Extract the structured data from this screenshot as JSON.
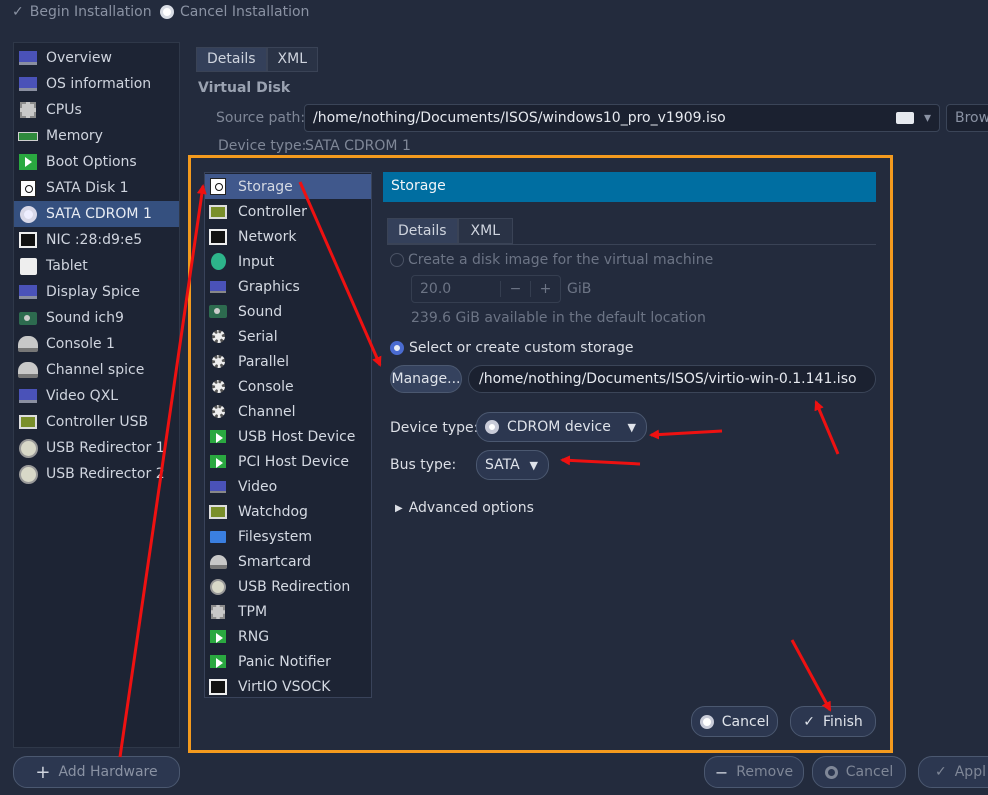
{
  "toolbar": {
    "begin": "Begin Installation",
    "cancel": "Cancel Installation"
  },
  "sidebar": {
    "items": [
      {
        "label": "Overview",
        "icon": "monitor-icon"
      },
      {
        "label": "OS information",
        "icon": "monitor-icon"
      },
      {
        "label": "CPUs",
        "icon": "cpu-icon"
      },
      {
        "label": "Memory",
        "icon": "memory-icon"
      },
      {
        "label": "Boot Options",
        "icon": "boot-icon"
      },
      {
        "label": "SATA Disk 1",
        "icon": "disk-icon"
      },
      {
        "label": "SATA CDROM 1",
        "icon": "cdrom-icon",
        "selected": true
      },
      {
        "label": "NIC :28:d9:e5",
        "icon": "nic-icon"
      },
      {
        "label": "Tablet",
        "icon": "tablet-icon"
      },
      {
        "label": "Display Spice",
        "icon": "display-icon"
      },
      {
        "label": "Sound ich9",
        "icon": "sound-icon"
      },
      {
        "label": "Console 1",
        "icon": "console-icon"
      },
      {
        "label": "Channel spice",
        "icon": "channel-icon"
      },
      {
        "label": "Video QXL",
        "icon": "video-icon"
      },
      {
        "label": "Controller USB",
        "icon": "controller-icon"
      },
      {
        "label": "USB Redirector 1",
        "icon": "usb-icon"
      },
      {
        "label": "USB Redirector 2",
        "icon": "usb-icon"
      }
    ],
    "add_hardware": "Add Hardware"
  },
  "main": {
    "tabs": [
      "Details",
      "XML"
    ],
    "section_title": "Virtual Disk",
    "source_path_label": "Source path:",
    "source_path_value": "/home/nothing/Documents/ISOS/windows10_pro_v1909.iso",
    "browse_label": "Brow",
    "device_type_label": "Device type:",
    "device_type_value": "SATA CDROM 1"
  },
  "dialog": {
    "hw_list": [
      {
        "label": "Storage",
        "icon": "storage-icon",
        "selected": true
      },
      {
        "label": "Controller",
        "icon": "controller-icon"
      },
      {
        "label": "Network",
        "icon": "network-icon"
      },
      {
        "label": "Input",
        "icon": "input-icon"
      },
      {
        "label": "Graphics",
        "icon": "graphics-icon"
      },
      {
        "label": "Sound",
        "icon": "sound-icon"
      },
      {
        "label": "Serial",
        "icon": "serial-icon"
      },
      {
        "label": "Parallel",
        "icon": "parallel-icon"
      },
      {
        "label": "Console",
        "icon": "console-icon"
      },
      {
        "label": "Channel",
        "icon": "channel-icon"
      },
      {
        "label": "USB Host Device",
        "icon": "usb-host-icon"
      },
      {
        "label": "PCI Host Device",
        "icon": "pci-host-icon"
      },
      {
        "label": "Video",
        "icon": "video-icon"
      },
      {
        "label": "Watchdog",
        "icon": "watchdog-icon"
      },
      {
        "label": "Filesystem",
        "icon": "folder-icon"
      },
      {
        "label": "Smartcard",
        "icon": "smartcard-icon"
      },
      {
        "label": "USB Redirection",
        "icon": "usb-icon"
      },
      {
        "label": "TPM",
        "icon": "tpm-icon"
      },
      {
        "label": "RNG",
        "icon": "rng-icon"
      },
      {
        "label": "Panic Notifier",
        "icon": "panic-icon"
      },
      {
        "label": "VirtIO VSOCK",
        "icon": "vsock-icon"
      }
    ],
    "banner": "Storage",
    "tabs": [
      "Details",
      "XML"
    ],
    "create_disk_label": "Create a disk image for the virtual machine",
    "size_value": "20.0",
    "size_unit": "GiB",
    "available_text": "239.6 GiB available in the default location",
    "custom_storage_label": "Select or create custom storage",
    "manage_label": "Manage...",
    "custom_path": "/home/nothing/Documents/ISOS/virtio-win-0.1.141.iso",
    "device_type_label": "Device type:",
    "device_type_value": "CDROM device",
    "bus_type_label": "Bus type:",
    "bus_type_value": "SATA",
    "advanced_label": "Advanced options",
    "cancel_label": "Cancel",
    "finish_label": "Finish"
  },
  "footer": {
    "remove": "Remove",
    "cancel": "Cancel",
    "apply": "Appl"
  },
  "colors": {
    "accent_border": "#f39a1e",
    "annotation_arrow": "#ee1111",
    "banner": "#006ea1"
  }
}
